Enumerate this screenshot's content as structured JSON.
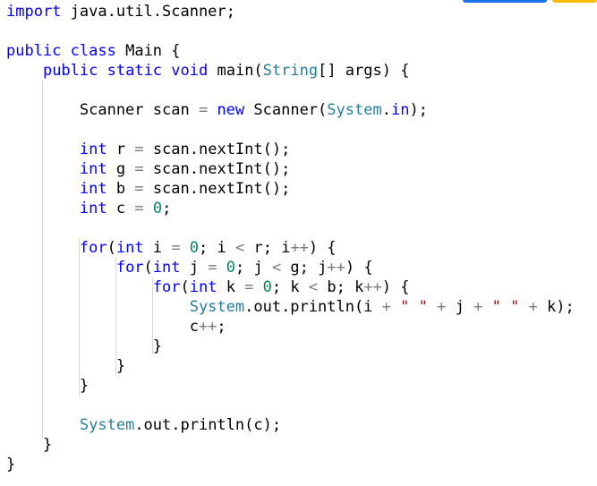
{
  "editor": {
    "language": "java",
    "tokens": [
      [
        [
          "kw",
          "import"
        ],
        [
          "tx",
          " java.util.Scanner;"
        ]
      ],
      [],
      [
        [
          "kw",
          "public"
        ],
        [
          "tx",
          " "
        ],
        [
          "kw",
          "class"
        ],
        [
          "tx",
          " Main {"
        ]
      ],
      [
        [
          "tx",
          "    "
        ],
        [
          "kw",
          "public"
        ],
        [
          "tx",
          " "
        ],
        [
          "kw",
          "static"
        ],
        [
          "tx",
          " "
        ],
        [
          "kw",
          "void"
        ],
        [
          "tx",
          " main("
        ],
        [
          "ty",
          "String"
        ],
        [
          "tx",
          "[] args) {"
        ]
      ],
      [],
      [
        [
          "tx",
          "        Scanner scan "
        ],
        [
          "op",
          "="
        ],
        [
          "tx",
          " "
        ],
        [
          "kw",
          "new"
        ],
        [
          "tx",
          " Scanner("
        ],
        [
          "ty",
          "System"
        ],
        [
          "tx",
          "."
        ],
        [
          "kw",
          "in"
        ],
        [
          "tx",
          ");"
        ]
      ],
      [],
      [
        [
          "tx",
          "        "
        ],
        [
          "kw",
          "int"
        ],
        [
          "tx",
          " r "
        ],
        [
          "op",
          "="
        ],
        [
          "tx",
          " scan.nextInt();"
        ]
      ],
      [
        [
          "tx",
          "        "
        ],
        [
          "kw",
          "int"
        ],
        [
          "tx",
          " g "
        ],
        [
          "op",
          "="
        ],
        [
          "tx",
          " scan.nextInt();"
        ]
      ],
      [
        [
          "tx",
          "        "
        ],
        [
          "kw",
          "int"
        ],
        [
          "tx",
          " b "
        ],
        [
          "op",
          "="
        ],
        [
          "tx",
          " scan.nextInt();"
        ]
      ],
      [
        [
          "tx",
          "        "
        ],
        [
          "kw",
          "int"
        ],
        [
          "tx",
          " c "
        ],
        [
          "op",
          "="
        ],
        [
          "tx",
          " "
        ],
        [
          "nm",
          "0"
        ],
        [
          "tx",
          ";"
        ]
      ],
      [],
      [
        [
          "tx",
          "        "
        ],
        [
          "kw",
          "for"
        ],
        [
          "tx",
          "("
        ],
        [
          "kw",
          "int"
        ],
        [
          "tx",
          " i "
        ],
        [
          "op",
          "="
        ],
        [
          "tx",
          " "
        ],
        [
          "nm",
          "0"
        ],
        [
          "tx",
          "; i "
        ],
        [
          "op",
          "<"
        ],
        [
          "tx",
          " r; i"
        ],
        [
          "op",
          "++"
        ],
        [
          "tx",
          ") {"
        ]
      ],
      [
        [
          "tx",
          "            "
        ],
        [
          "kw",
          "for"
        ],
        [
          "tx",
          "("
        ],
        [
          "kw",
          "int"
        ],
        [
          "tx",
          " j "
        ],
        [
          "op",
          "="
        ],
        [
          "tx",
          " "
        ],
        [
          "nm",
          "0"
        ],
        [
          "tx",
          "; j "
        ],
        [
          "op",
          "<"
        ],
        [
          "tx",
          " g; j"
        ],
        [
          "op",
          "++"
        ],
        [
          "tx",
          ") {"
        ]
      ],
      [
        [
          "tx",
          "                "
        ],
        [
          "kw",
          "for"
        ],
        [
          "tx",
          "("
        ],
        [
          "kw",
          "int"
        ],
        [
          "tx",
          " k "
        ],
        [
          "op",
          "="
        ],
        [
          "tx",
          " "
        ],
        [
          "nm",
          "0"
        ],
        [
          "tx",
          "; k "
        ],
        [
          "op",
          "<"
        ],
        [
          "tx",
          " b; k"
        ],
        [
          "op",
          "++"
        ],
        [
          "tx",
          ") {"
        ]
      ],
      [
        [
          "tx",
          "                    "
        ],
        [
          "ty",
          "System"
        ],
        [
          "tx",
          ".out.println(i "
        ],
        [
          "op",
          "+"
        ],
        [
          "tx",
          " "
        ],
        [
          "st",
          "\" \""
        ],
        [
          "tx",
          " "
        ],
        [
          "op",
          "+"
        ],
        [
          "tx",
          " j "
        ],
        [
          "op",
          "+"
        ],
        [
          "tx",
          " "
        ],
        [
          "st",
          "\" \""
        ],
        [
          "tx",
          " "
        ],
        [
          "op",
          "+"
        ],
        [
          "tx",
          " k);"
        ]
      ],
      [
        [
          "tx",
          "                    c"
        ],
        [
          "op",
          "++"
        ],
        [
          "tx",
          ";"
        ]
      ],
      [
        [
          "tx",
          "                }"
        ]
      ],
      [
        [
          "tx",
          "            }"
        ]
      ],
      [
        [
          "tx",
          "        }"
        ]
      ],
      [],
      [
        [
          "tx",
          "        "
        ],
        [
          "ty",
          "System"
        ],
        [
          "tx",
          ".out.println(c);"
        ]
      ],
      [
        [
          "tx",
          "    }"
        ]
      ],
      [
        [
          "tx",
          "}"
        ]
      ]
    ]
  },
  "colors": {
    "kw": "#0000ff",
    "ty": "#267f99",
    "tx": "#000000",
    "op": "#7a7a7a",
    "nm": "#098658",
    "st": "#a31515"
  }
}
